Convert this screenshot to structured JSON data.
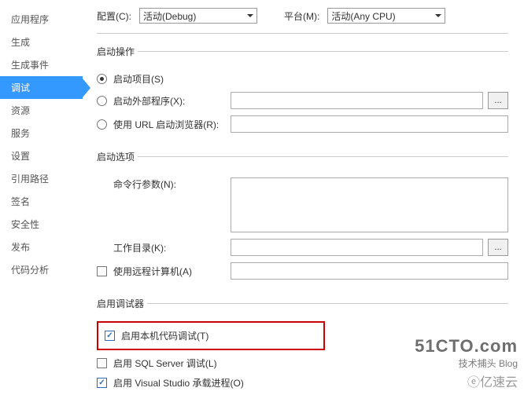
{
  "sidebar": {
    "items": [
      {
        "label": "应用程序"
      },
      {
        "label": "生成"
      },
      {
        "label": "生成事件"
      },
      {
        "label": "调试"
      },
      {
        "label": "资源"
      },
      {
        "label": "服务"
      },
      {
        "label": "设置"
      },
      {
        "label": "引用路径"
      },
      {
        "label": "签名"
      },
      {
        "label": "安全性"
      },
      {
        "label": "发布"
      },
      {
        "label": "代码分析"
      }
    ],
    "active": "调试"
  },
  "top": {
    "config_label": "配置(C):",
    "config_value": "活动(Debug)",
    "platform_label": "平台(M):",
    "platform_value": "活动(Any CPU)"
  },
  "start_action": {
    "legend": "启动操作",
    "proj": "启动项目(S)",
    "ext": "启动外部程序(X):",
    "url": "使用 URL 启动浏览器(R):",
    "browse": "..."
  },
  "start_options": {
    "legend": "启动选项",
    "args": "命令行参数(N):",
    "workdir": "工作目录(K):",
    "remote": "使用远程计算机(A)",
    "browse": "..."
  },
  "debuggers": {
    "legend": "启用调试器",
    "native": "启用本机代码调试(T)",
    "sql": "启用 SQL Server 调试(L)",
    "vshost": "启用 Visual Studio 承载进程(O)"
  },
  "watermark": {
    "line1": "51CTO.com",
    "line2": "技术捕头        Blog",
    "line3": "ⓔ亿速云"
  }
}
